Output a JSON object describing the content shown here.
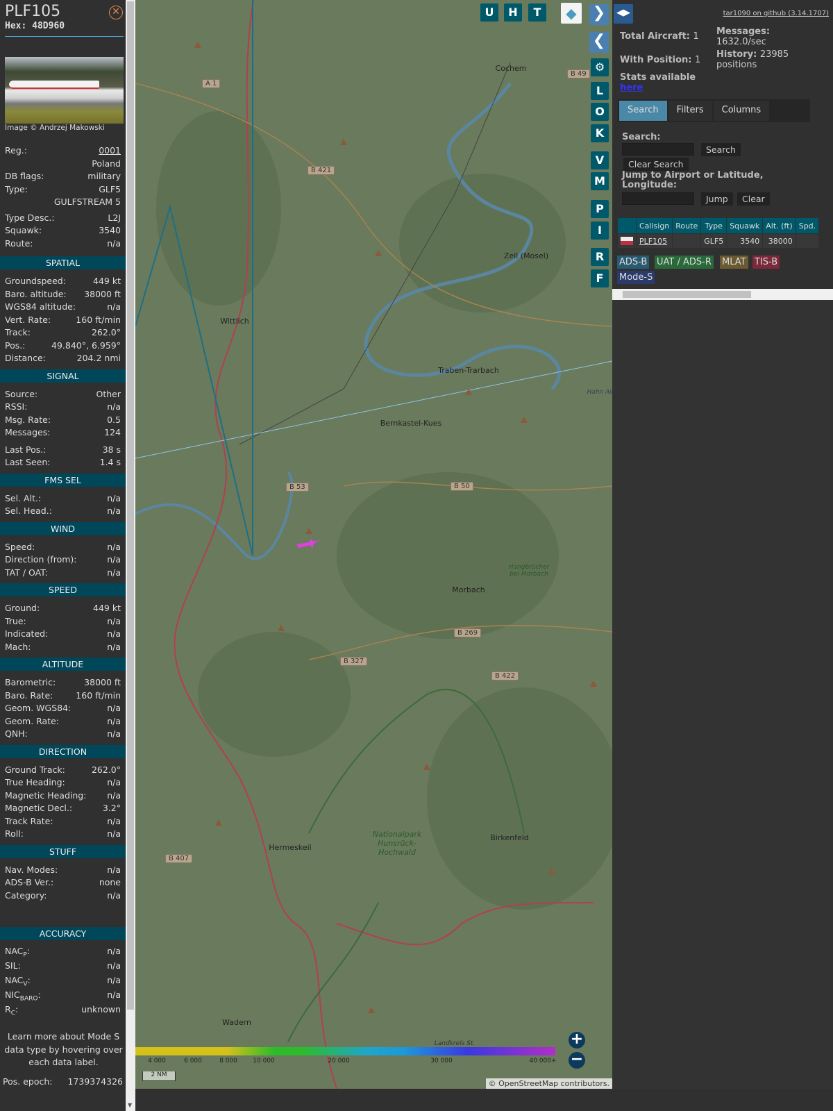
{
  "aircraft": {
    "callsign": "PLF105",
    "hex_label": "Hex: 48D960",
    "image_credit": "Image © Andrzej Makowski"
  },
  "info": [
    [
      "Reg.:",
      "0001"
    ],
    [
      "",
      "Poland"
    ],
    [
      "DB flags:",
      "military"
    ],
    [
      "Type:",
      "GLF5"
    ],
    [
      "",
      "GULFSTREAM 5"
    ],
    [
      "Type Desc.:",
      "L2J"
    ],
    [
      "Squawk:",
      "3540"
    ],
    [
      "Route:",
      "n/a"
    ]
  ],
  "sections": [
    {
      "title": "SPATIAL",
      "rows": [
        [
          "Groundspeed:",
          "449 kt"
        ],
        [
          "Baro. altitude:",
          "38000 ft"
        ],
        [
          "WGS84 altitude:",
          "n/a"
        ],
        [
          "Vert. Rate:",
          "160 ft/min"
        ],
        [
          "Track:",
          "262.0°"
        ],
        [
          "Pos.:",
          "49.840°, 6.959°"
        ],
        [
          "Distance:",
          "204.2 nmi"
        ]
      ]
    },
    {
      "title": "SIGNAL",
      "rows": [
        [
          "Source:",
          "Other"
        ],
        [
          "RSSI:",
          "n/a"
        ],
        [
          "Msg. Rate:",
          "0.5"
        ],
        [
          "Messages:",
          "124"
        ],
        [
          "Last Pos.:",
          "38 s"
        ],
        [
          "Last Seen:",
          "1.4 s"
        ]
      ]
    },
    {
      "title": "FMS SEL",
      "rows": [
        [
          "Sel. Alt.:",
          "n/a"
        ],
        [
          "Sel. Head.:",
          "n/a"
        ]
      ]
    },
    {
      "title": "WIND",
      "rows": [
        [
          "Speed:",
          "n/a"
        ],
        [
          "Direction (from):",
          "n/a"
        ],
        [
          "TAT / OAT:",
          "n/a"
        ]
      ]
    },
    {
      "title": "SPEED",
      "rows": [
        [
          "Ground:",
          "449 kt"
        ],
        [
          "True:",
          "n/a"
        ],
        [
          "Indicated:",
          "n/a"
        ],
        [
          "Mach:",
          "n/a"
        ]
      ]
    },
    {
      "title": "ALTITUDE",
      "rows": [
        [
          "Barometric:",
          "38000 ft"
        ],
        [
          "Baro. Rate:",
          "160 ft/min"
        ],
        [
          "Geom. WGS84:",
          "n/a"
        ],
        [
          "Geom. Rate:",
          "n/a"
        ],
        [
          "QNH:",
          "n/a"
        ]
      ]
    },
    {
      "title": "DIRECTION",
      "rows": [
        [
          "Ground Track:",
          "262.0°"
        ],
        [
          "True Heading:",
          "n/a"
        ],
        [
          "Magnetic Heading:",
          "n/a"
        ],
        [
          "Magnetic Decl.:",
          "3.2°"
        ],
        [
          "Track Rate:",
          "n/a"
        ],
        [
          "Roll:",
          "n/a"
        ]
      ]
    },
    {
      "title": "STUFF",
      "rows": [
        [
          "Nav. Modes:",
          "n/a"
        ],
        [
          "ADS-B Ver.:",
          "none"
        ],
        [
          "Category:",
          "n/a"
        ]
      ]
    }
  ],
  "accuracy": {
    "title": "ACCURACY",
    "rows": [
      [
        "NAC",
        "P",
        ":",
        "n/a"
      ],
      [
        "SIL:",
        "",
        "",
        "n/a"
      ],
      [
        "NAC",
        "V",
        ":",
        "n/a"
      ],
      [
        "NIC",
        "BARO",
        ":",
        "n/a"
      ],
      [
        "R",
        "C",
        ":",
        "unknown"
      ]
    ]
  },
  "help_text": "Learn more about Mode S data type by hovering over each data label.",
  "pos_epoch": {
    "label": "Pos. epoch:",
    "value": "1739374326"
  },
  "map": {
    "top_buttons": [
      "U",
      "H",
      "T"
    ],
    "side_buttons": [
      "L",
      "O",
      "K",
      "V",
      "M",
      "P",
      "I",
      "R",
      "F"
    ],
    "towns": [
      "Cochem",
      "Zell (Mosel)",
      "Wittlich",
      "Traben-Trarbach",
      "Bernkastel-Kues",
      "Morbach",
      "Hermeskeil",
      "Birkenfeld",
      "Wadern",
      "Hahn Air"
    ],
    "parks": [
      "Nationalpark Hunsrück-Hochwald",
      "Hangbrücher bei Morbach",
      "Landkreis St. Wendel"
    ],
    "roads": [
      "B 49",
      "A 1",
      "B 421",
      "B 53",
      "B 50",
      "B 269",
      "B 327",
      "B 422",
      "B 407"
    ],
    "altitude_legend": [
      "4 000",
      "6 000",
      "8 000",
      "10 000",
      "20 000",
      "30 000",
      "40 000+"
    ],
    "scale": "2 NM",
    "attribution": "© OpenStreetMap contributors."
  },
  "right": {
    "github": "tar1090 on github (3.14.1707)",
    "total_aircraft_label": "Total Aircraft:",
    "total_aircraft": "1",
    "with_position_label": "With Position:",
    "with_position": "1",
    "messages_label": "Messages:",
    "messages": "1632.0/sec",
    "history_label": "History:",
    "history": "23985",
    "history_unit": "positions",
    "stats_label": "Stats available",
    "stats_link": "here",
    "tabs": [
      "Search",
      "Filters",
      "Columns"
    ],
    "search_label": "Search:",
    "search_button": "Search",
    "clear_search": "Clear Search",
    "jump_label": "Jump to Airport or Latitude, Longitude:",
    "jump_button": "Jump",
    "clear_button": "Clear",
    "table": {
      "headers": [
        "",
        "Callsign",
        "Route",
        "Type",
        "Squawk",
        "Alt. (ft)",
        "Spd."
      ],
      "rows": [
        [
          "",
          "PLF105",
          "",
          "GLF5",
          "3540",
          "38000",
          ""
        ]
      ]
    },
    "source_tags": [
      "ADS-B",
      "UAT / ADS-R",
      "MLAT",
      "TIS-B",
      "Mode-S"
    ],
    "colors": {
      "adsb": "#2a5a72",
      "uat": "#2a6a3a",
      "mlat": "#6a5a32",
      "tisb": "#7a2a3a",
      "modes": "#2a3a6a"
    }
  }
}
